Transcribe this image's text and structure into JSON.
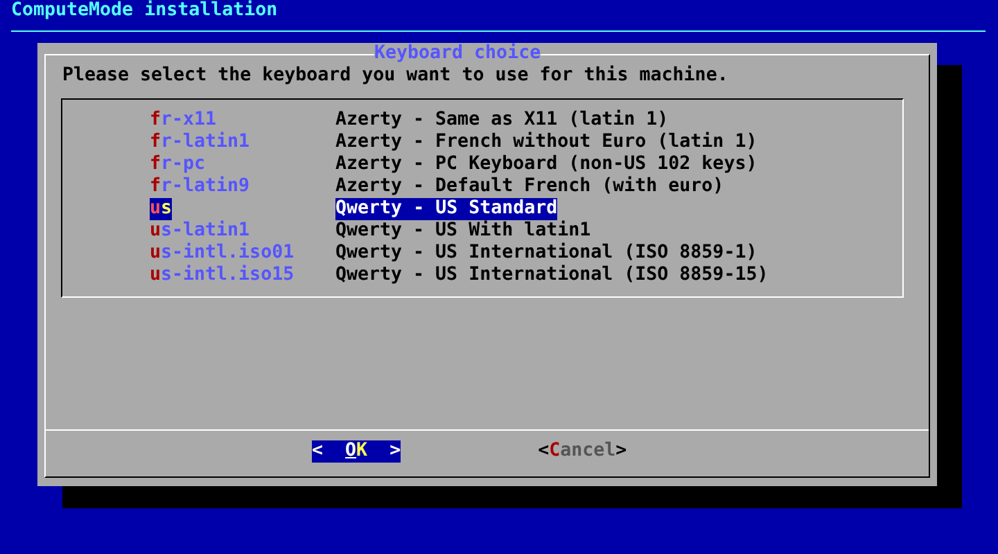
{
  "screen_title": "ComputeMode installation",
  "dialog": {
    "title": "Keyboard choice",
    "prompt": "Please select the keyboard you want to use for this machine.",
    "items": [
      {
        "tag": "fr-x11",
        "description": "Azerty - Same as X11 (latin 1)",
        "selected": false
      },
      {
        "tag": "fr-latin1",
        "description": "Azerty - French without Euro (latin 1)",
        "selected": false
      },
      {
        "tag": "fr-pc",
        "description": "Azerty - PC Keyboard (non-US 102 keys)",
        "selected": false
      },
      {
        "tag": "fr-latin9",
        "description": "Azerty - Default French (with euro)",
        "selected": false
      },
      {
        "tag": "us",
        "description": "Qwerty - US Standard",
        "selected": true
      },
      {
        "tag": "us-latin1",
        "description": "Qwerty - US With latin1",
        "selected": false
      },
      {
        "tag": "us-intl.iso01",
        "description": "Qwerty - US International (ISO 8859-1)",
        "selected": false
      },
      {
        "tag": "us-intl.iso15",
        "description": "Qwerty - US International (ISO 8859-15)",
        "selected": false
      }
    ],
    "buttons": [
      {
        "label": "<  OK  >",
        "selected": true
      },
      {
        "label": "<Cancel>",
        "selected": false
      }
    ]
  }
}
